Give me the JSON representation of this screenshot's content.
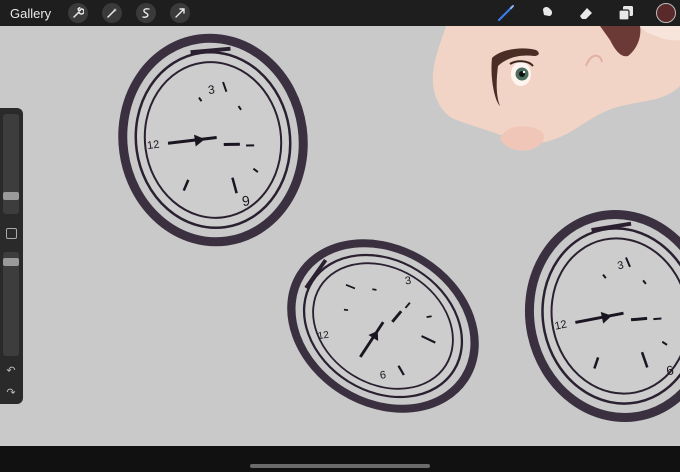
{
  "topbar": {
    "gallery_label": "Gallery",
    "left_tools": [
      "wrench-icon",
      "magic-wand-icon",
      "selection-icon",
      "transform-icon"
    ],
    "right_tools": [
      "brush-icon",
      "smudge-icon",
      "eraser-icon",
      "layers-icon"
    ],
    "active_tool": "brush-icon",
    "accent_color": "#3b7bea",
    "current_color": "#5a2a2a"
  },
  "canvas": {
    "background_color": "#c9c9c9",
    "clock_numerals": {
      "twelve": "12",
      "three": "3",
      "six": "6"
    }
  },
  "sidebar": {
    "undo_icon": "undo-icon",
    "redo_icon": "redo-icon"
  }
}
